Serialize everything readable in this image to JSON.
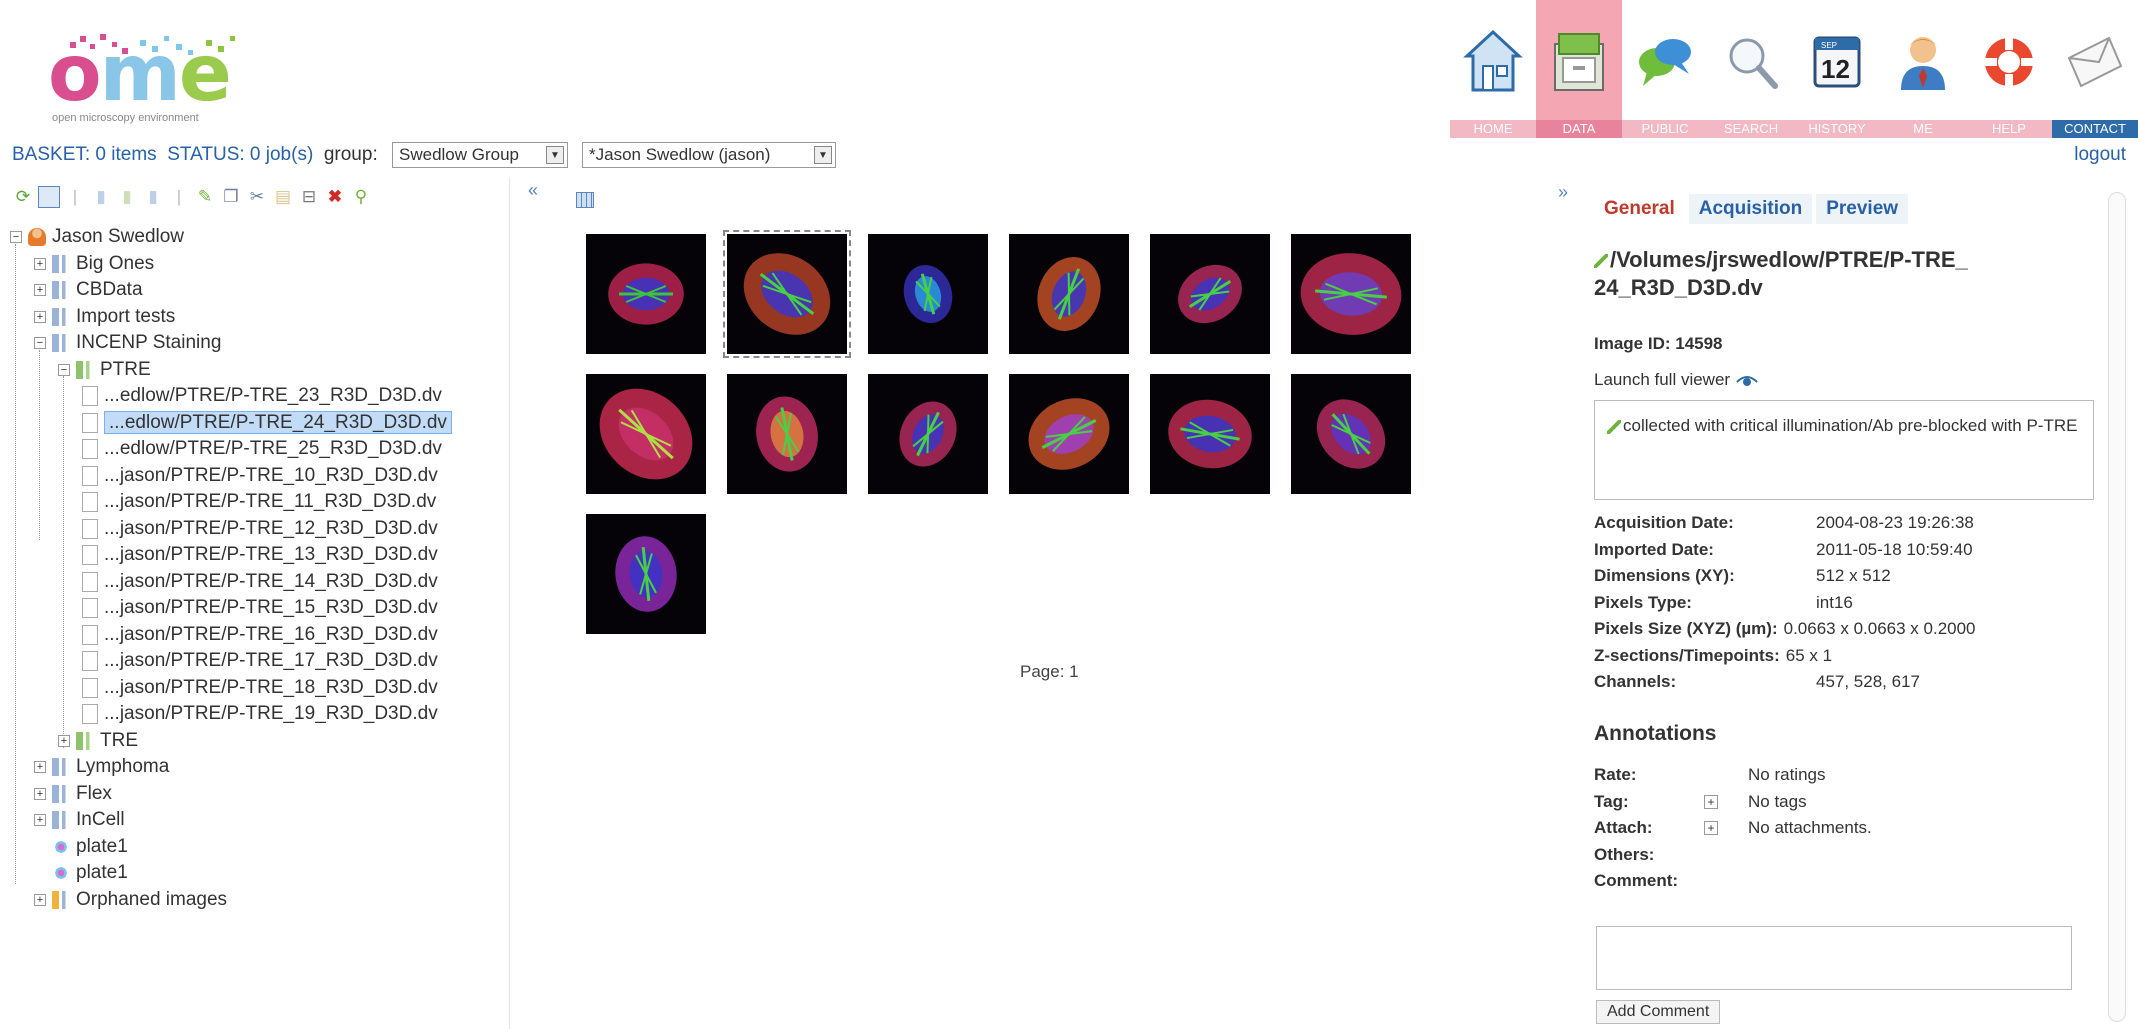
{
  "logo": {
    "word": "ome",
    "subtitle": "open microscopy environment"
  },
  "nav": [
    {
      "label": "HOME",
      "icon": "home-icon"
    },
    {
      "label": "DATA",
      "icon": "data-drawer-icon",
      "active": true
    },
    {
      "label": "PUBLIC",
      "icon": "speech-bubbles-icon"
    },
    {
      "label": "SEARCH",
      "icon": "magnifier-icon"
    },
    {
      "label": "HISTORY",
      "icon": "calendar-icon",
      "calendar_month": "SEP",
      "calendar_day": "12"
    },
    {
      "label": "ME",
      "icon": "user-icon"
    },
    {
      "label": "HELP",
      "icon": "lifebuoy-icon"
    },
    {
      "label": "CONTACT",
      "icon": "envelope-icon"
    }
  ],
  "status": {
    "basket": "BASKET: 0 items",
    "status": "STATUS: 0 job(s)",
    "group_label": "group:",
    "group_value": "Swedlow Group",
    "user_value": "*Jason Swedlow (jason)",
    "logout": "logout"
  },
  "tree": {
    "root": "Jason Swedlow",
    "projects": [
      "Big Ones",
      "CBData",
      "Import tests",
      "INCENP Staining"
    ],
    "dataset_open": "PTRE",
    "images": [
      "...edlow/PTRE/P-TRE_23_R3D_D3D.dv",
      "...edlow/PTRE/P-TRE_24_R3D_D3D.dv",
      "...edlow/PTRE/P-TRE_25_R3D_D3D.dv",
      "...jason/PTRE/P-TRE_10_R3D_D3D.dv",
      "...jason/PTRE/P-TRE_11_R3D_D3D.dv",
      "...jason/PTRE/P-TRE_12_R3D_D3D.dv",
      "...jason/PTRE/P-TRE_13_R3D_D3D.dv",
      "...jason/PTRE/P-TRE_14_R3D_D3D.dv",
      "...jason/PTRE/P-TRE_15_R3D_D3D.dv",
      "...jason/PTRE/P-TRE_16_R3D_D3D.dv",
      "...jason/PTRE/P-TRE_17_R3D_D3D.dv",
      "...jason/PTRE/P-TRE_18_R3D_D3D.dv",
      "...jason/PTRE/P-TRE_19_R3D_D3D.dv"
    ],
    "selected_image": 1,
    "dataset_closed": "TRE",
    "projects_after": [
      "Lymphoma",
      "Flex",
      "InCell"
    ],
    "plates": [
      "plate1",
      "plate1"
    ],
    "orphaned": "Orphaned images"
  },
  "thumbnails": {
    "count": 13,
    "selected": 1,
    "page_label": "Page: 1"
  },
  "right": {
    "tabs": [
      "General",
      "Acquisition",
      "Preview"
    ],
    "active_tab": "General",
    "path_title": "/Volumes/jrswedlow/PTRE/P-TRE_ 24_R3D_D3D.dv",
    "image_id": "Image ID: 14598",
    "launch": "Launch full viewer",
    "description": "collected with critical illumination/Ab pre-blocked with P-TRE",
    "meta": [
      {
        "k": "Acquisition Date:",
        "v": "2004-08-23 19:26:38"
      },
      {
        "k": "Imported Date:",
        "v": "2011-05-18 10:59:40"
      },
      {
        "k": "Dimensions (XY):",
        "v": "512 x 512"
      },
      {
        "k": "Pixels Type:",
        "v": "int16"
      },
      {
        "k": "Pixels Size (XYZ) (µm):",
        "v": "0.0663 x 0.0663 x 0.2000"
      },
      {
        "k": "Z-sections/Timepoints:",
        "v": "65 x 1"
      },
      {
        "k": "Channels:",
        "v": "457, 528, 617"
      }
    ],
    "annotations_title": "Annotations",
    "annotations": [
      {
        "k": "Rate:",
        "v": "No ratings",
        "plus": false
      },
      {
        "k": "Tag:",
        "v": "No tags",
        "plus": true
      },
      {
        "k": "Attach:",
        "v": "No attachments.",
        "plus": true
      },
      {
        "k": "Others:",
        "v": "",
        "plus": false
      },
      {
        "k": "Comment:",
        "v": "",
        "plus": false
      }
    ],
    "add_comment": "Add Comment"
  }
}
